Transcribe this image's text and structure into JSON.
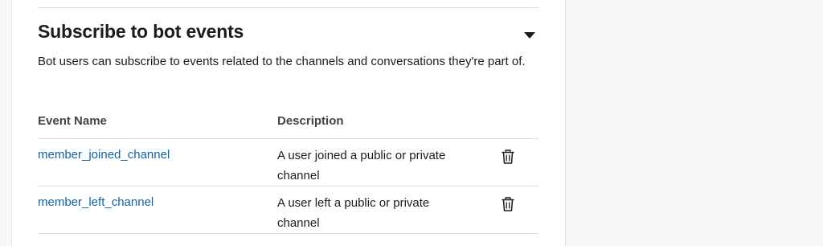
{
  "section": {
    "title": "Subscribe to bot events",
    "description": "Bot users can subscribe to events related to the channels and conversations they're part of."
  },
  "table": {
    "headers": {
      "name": "Event Name",
      "description": "Description"
    },
    "rows": [
      {
        "name": "member_joined_channel",
        "description": "A user joined a public or private channel"
      },
      {
        "name": "member_left_channel",
        "description": "A user left a public or private channel"
      }
    ]
  },
  "icons": {
    "collapse": "caret-down-icon",
    "delete": "trash-icon"
  },
  "colors": {
    "link": "#1264a3",
    "text": "#1d1c1d",
    "border": "#dddddd",
    "background": "#f8f8f8"
  }
}
